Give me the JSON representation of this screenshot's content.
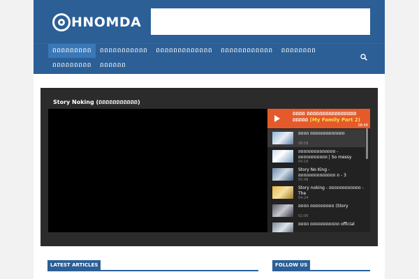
{
  "site": {
    "logo_text": "HNOMDA",
    "accent": "#2b5f96",
    "highlight": "#e55a2b"
  },
  "nav": {
    "row1": [
      "ពពពពពពពពព",
      "ពពពពពពពពពពព",
      "ពពពពពពពពពពពពព",
      "ពពពពពពពពពពពព",
      "ពពពពពពពព"
    ],
    "row2": [
      "ពពពពពពពពព",
      "ពពពពពព"
    ],
    "search_icon": "search-icon"
  },
  "video": {
    "title": "Story Noking (ពពពពពពពពពពព)",
    "playlist_head": {
      "title": "ពពពព ពពពពពពពពពពពពពពពព ពពពពព",
      "suffix": "(My Family Part 2)",
      "duration": "08:48"
    },
    "items": [
      {
        "title": "ពពពព ពពពពពពពពពពពពព",
        "duration": "08:58"
      },
      {
        "title": "ពពពពពពពពពពពពពព - ពពពពពពពពពពព | So messy",
        "duration": "04:16"
      },
      {
        "title": "Story No King - ពពពពពពពពពពពពពព ព - 3",
        "duration": "05:48"
      },
      {
        "title": "Story noking - ពពពពពពពពពពពព - The",
        "duration": "04:24"
      },
      {
        "title": "ពពពព ពពពពពពពពព (Story",
        "duration": "02:06"
      },
      {
        "title": "ពពពព ពពពពពពពពពពព official",
        "duration": ""
      }
    ]
  },
  "sections": {
    "latest": "LATEST ARTICLES",
    "follow": "FOLLOW US"
  }
}
